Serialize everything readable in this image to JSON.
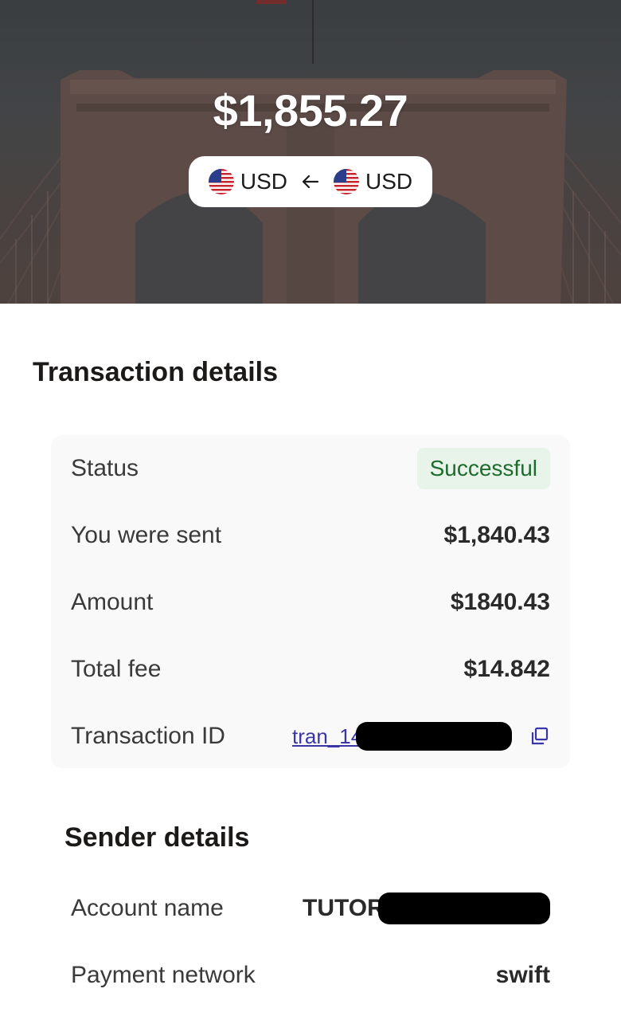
{
  "hero": {
    "amount": "$1,855.27",
    "to_currency": "USD",
    "from_currency": "USD",
    "flag_icon": "us-flag-icon",
    "arrow_icon": "arrow-left-icon"
  },
  "transaction": {
    "title": "Transaction details",
    "status_label": "Status",
    "status_value": "Successful",
    "sent_label": "You were sent",
    "sent_value": "$1,840.43",
    "amount_label": "Amount",
    "amount_value": "$1840.43",
    "fee_label": "Total fee",
    "fee_value": "$14.842",
    "id_label": "Transaction ID",
    "id_value_visible": "tran_14",
    "copy_icon": "copy-icon"
  },
  "sender": {
    "title": "Sender details",
    "account_name_label": "Account name",
    "account_name_visible": "TUTOR",
    "payment_network_label": "Payment network",
    "payment_network_value": "swift"
  },
  "colors": {
    "status_bg": "#e8f4ea",
    "status_text": "#1f6b2e",
    "link": "#3b36a8",
    "card_bg": "#f9f9f9"
  }
}
